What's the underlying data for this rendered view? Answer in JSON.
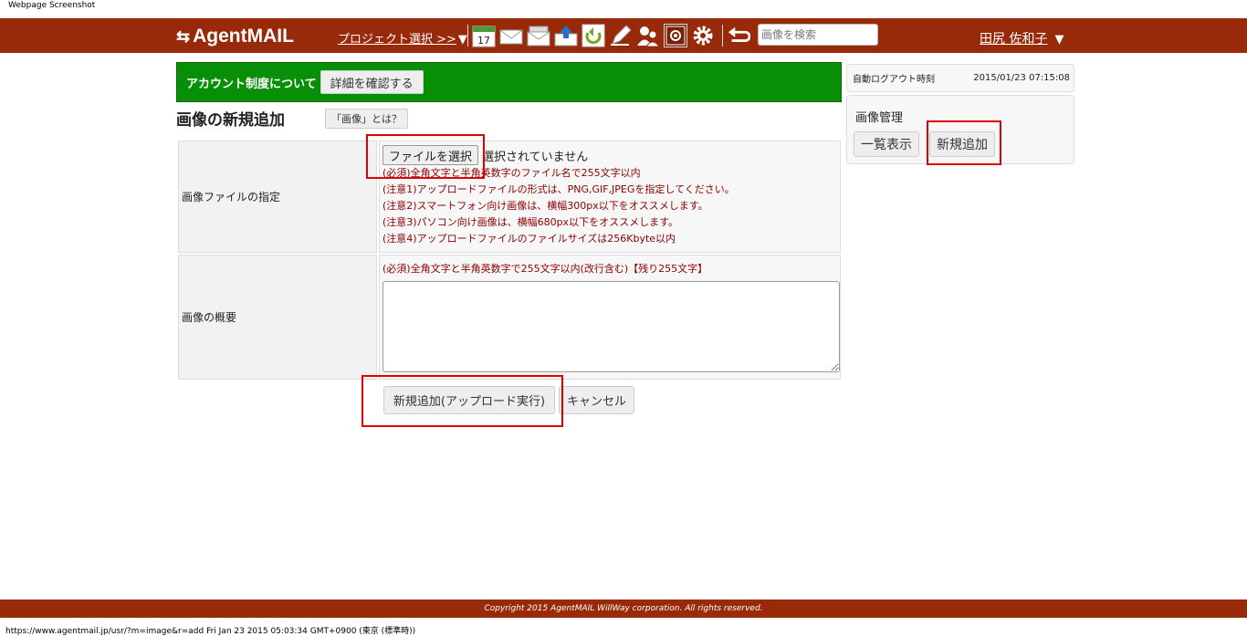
{
  "caption": "Webpage Screenshot",
  "header": {
    "logo_text": "AgentMAIL",
    "project_select": "プロジェクト選択 >>",
    "search_placeholder": "画像を検索",
    "user_name": "田尻 佐和子",
    "calendar_day": "17",
    "icons": [
      "calendar-icon",
      "mail-icon",
      "mail-stack-icon",
      "upload-icon",
      "refresh-icon",
      "pencil-icon",
      "users-icon",
      "image-manager-icon",
      "gear-icon",
      "back-arrow-icon"
    ],
    "bar_color": "#982a0a"
  },
  "banner": {
    "text": "アカウント制度について",
    "button": "詳細を確認する",
    "color": "#079007"
  },
  "page": {
    "title": "画像の新規追加",
    "help_button": "「画像」とは？"
  },
  "form": {
    "file_label": "画像ファイルの指定",
    "file_button": "ファイルを選択",
    "file_status": "選択されていません",
    "file_notes": [
      "(必須)全角文字と半角英数字のファイル名で255文字以内",
      "(注意1)アップロードファイルの形式は、PNG,GIF,JPEGを指定してください。",
      "(注意2)スマートフォン向け画像は、横幅300px以下をオススメします。",
      "(注意3)パソコン向け画像は、横幅680px以下をオススメします。",
      "(注意4)アップロードファイルのファイルサイズは256Kbyte以内"
    ],
    "desc_label": "画像の概要",
    "desc_note": "(必須)全角文字と半角英数字で255文字以内(改行含む)【残り255文字】",
    "desc_value": "",
    "submit": "新規追加(アップロード実行)",
    "cancel": "キャンセル"
  },
  "sidebar": {
    "logout_label": "自動ログアウト時刻",
    "logout_time": "2015/01/23 07:15:08",
    "panel_title": "画像管理",
    "list_button": "一覧表示",
    "new_button": "新規追加"
  },
  "footer": {
    "copyright": "Copyright 2015 AgentMAIL WillWay corporation. All rights reserved."
  },
  "statusbar": "https://www.agentmail.jp/usr/?m=image&r=add Fri Jan 23 2015 05:03:34 GMT+0900 (東京 (標準時))"
}
